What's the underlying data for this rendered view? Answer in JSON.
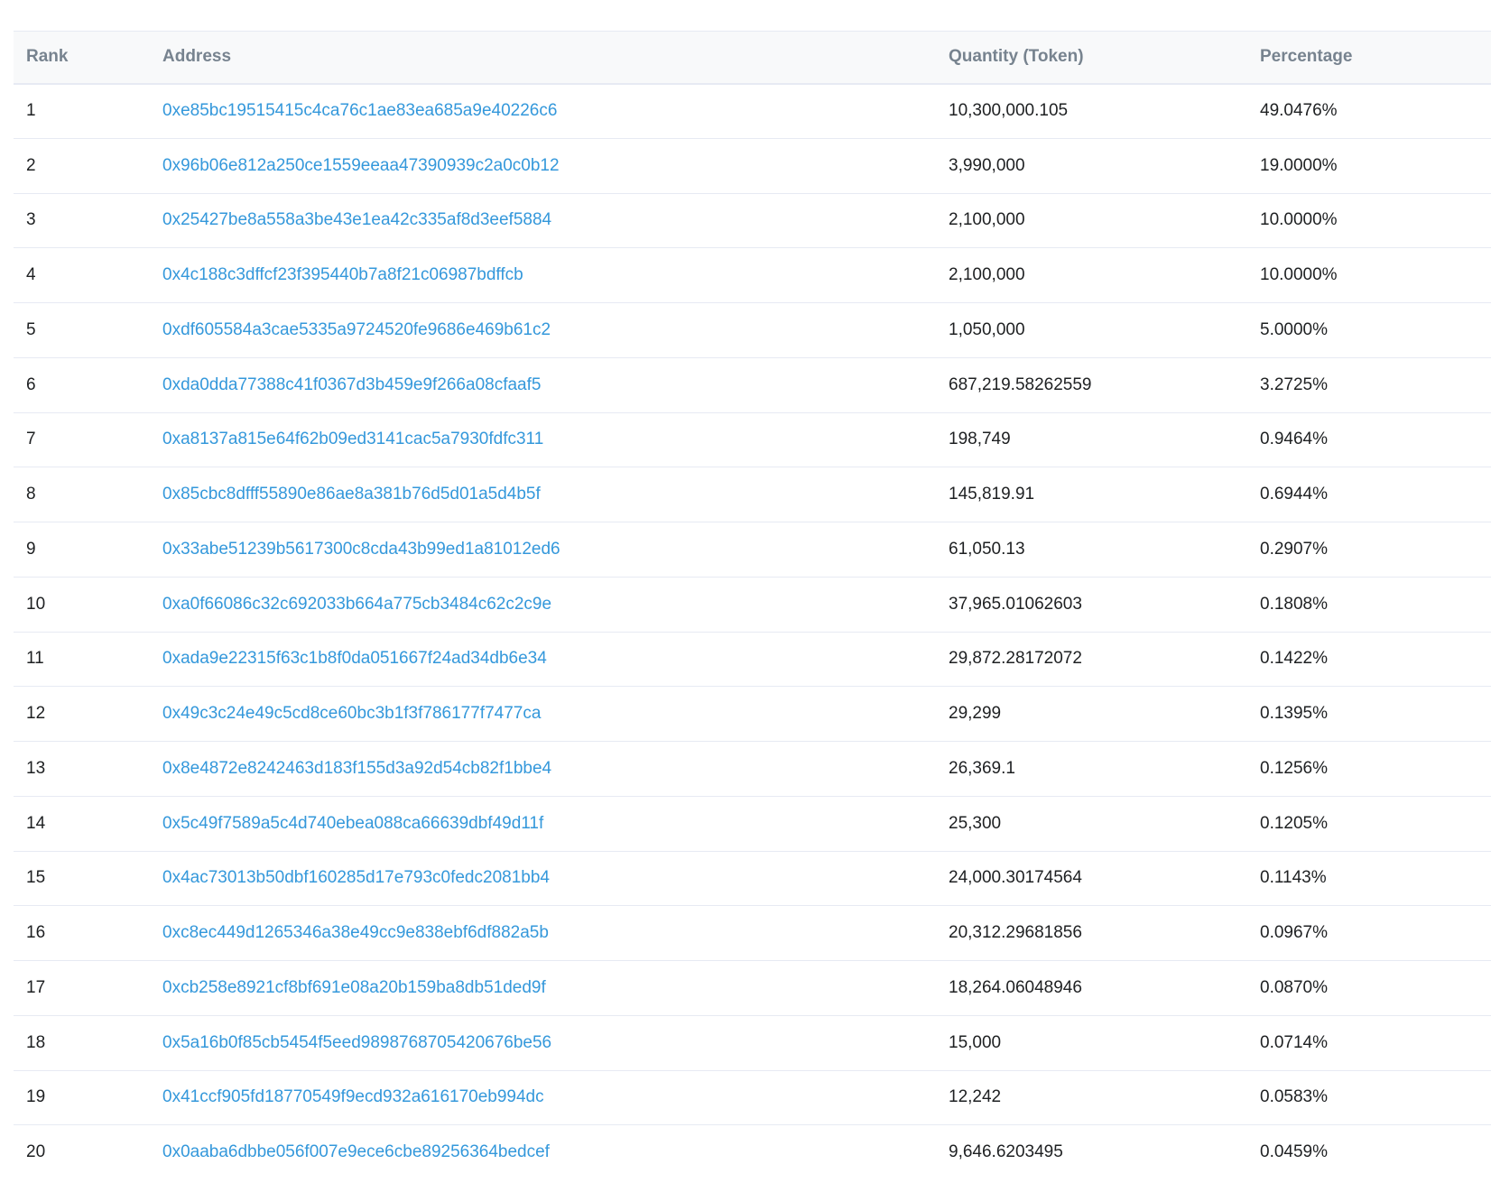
{
  "table": {
    "headers": {
      "rank": "Rank",
      "address": "Address",
      "quantity": "Quantity (Token)",
      "percentage": "Percentage"
    },
    "rows": [
      {
        "rank": "1",
        "address": "0xe85bc19515415c4ca76c1ae83ea685a9e40226c6",
        "quantity": "10,300,000.105",
        "percentage": "49.0476%"
      },
      {
        "rank": "2",
        "address": "0x96b06e812a250ce1559eeaa47390939c2a0c0b12",
        "quantity": "3,990,000",
        "percentage": "19.0000%"
      },
      {
        "rank": "3",
        "address": "0x25427be8a558a3be43e1ea42c335af8d3eef5884",
        "quantity": "2,100,000",
        "percentage": "10.0000%"
      },
      {
        "rank": "4",
        "address": "0x4c188c3dffcf23f395440b7a8f21c06987bdffcb",
        "quantity": "2,100,000",
        "percentage": "10.0000%"
      },
      {
        "rank": "5",
        "address": "0xdf605584a3cae5335a9724520fe9686e469b61c2",
        "quantity": "1,050,000",
        "percentage": "5.0000%"
      },
      {
        "rank": "6",
        "address": "0xda0dda77388c41f0367d3b459e9f266a08cfaaf5",
        "quantity": "687,219.58262559",
        "percentage": "3.2725%"
      },
      {
        "rank": "7",
        "address": "0xa8137a815e64f62b09ed3141cac5a7930fdfc311",
        "quantity": "198,749",
        "percentage": "0.9464%"
      },
      {
        "rank": "8",
        "address": "0x85cbc8dfff55890e86ae8a381b76d5d01a5d4b5f",
        "quantity": "145,819.91",
        "percentage": "0.6944%"
      },
      {
        "rank": "9",
        "address": "0x33abe51239b5617300c8cda43b99ed1a81012ed6",
        "quantity": "61,050.13",
        "percentage": "0.2907%"
      },
      {
        "rank": "10",
        "address": "0xa0f66086c32c692033b664a775cb3484c62c2c9e",
        "quantity": "37,965.01062603",
        "percentage": "0.1808%"
      },
      {
        "rank": "11",
        "address": "0xada9e22315f63c1b8f0da051667f24ad34db6e34",
        "quantity": "29,872.28172072",
        "percentage": "0.1422%"
      },
      {
        "rank": "12",
        "address": "0x49c3c24e49c5cd8ce60bc3b1f3f786177f7477ca",
        "quantity": "29,299",
        "percentage": "0.1395%"
      },
      {
        "rank": "13",
        "address": "0x8e4872e8242463d183f155d3a92d54cb82f1bbe4",
        "quantity": "26,369.1",
        "percentage": "0.1256%"
      },
      {
        "rank": "14",
        "address": "0x5c49f7589a5c4d740ebea088ca66639dbf49d11f",
        "quantity": "25,300",
        "percentage": "0.1205%"
      },
      {
        "rank": "15",
        "address": "0x4ac73013b50dbf160285d17e793c0fedc2081bb4",
        "quantity": "24,000.30174564",
        "percentage": "0.1143%"
      },
      {
        "rank": "16",
        "address": "0xc8ec449d1265346a38e49cc9e838ebf6df882a5b",
        "quantity": "20,312.29681856",
        "percentage": "0.0967%"
      },
      {
        "rank": "17",
        "address": "0xcb258e8921cf8bf691e08a20b159ba8db51ded9f",
        "quantity": "18,264.06048946",
        "percentage": "0.0870%"
      },
      {
        "rank": "18",
        "address": "0x5a16b0f85cb5454f5eed9898768705420676be56",
        "quantity": "15,000",
        "percentage": "0.0714%"
      },
      {
        "rank": "19",
        "address": "0x41ccf905fd18770549f9ecd932a616170eb994dc",
        "quantity": "12,242",
        "percentage": "0.0583%"
      },
      {
        "rank": "20",
        "address": "0x0aaba6dbbe056f007e9ece6cbe89256364bedcef",
        "quantity": "9,646.6203495",
        "percentage": "0.0459%"
      }
    ]
  },
  "colors": {
    "link": "#3498db",
    "header_bg": "#f8f9fa",
    "header_text": "#77838f",
    "border": "#e7eaf3"
  }
}
